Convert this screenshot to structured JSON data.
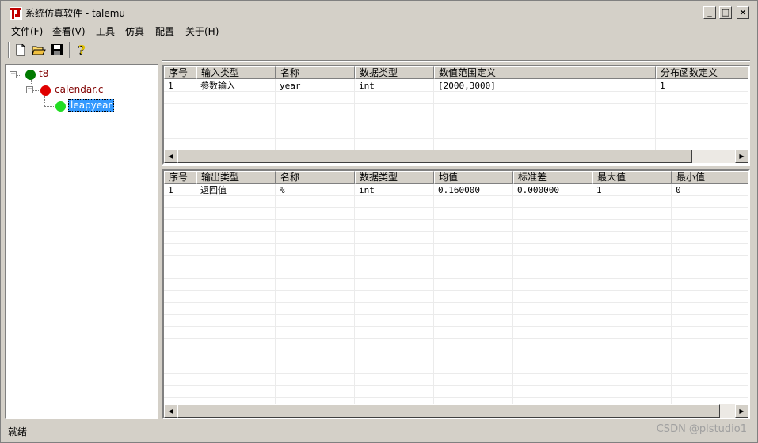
{
  "window": {
    "title": "系统仿真软件 - talemu",
    "buttons": [
      "_",
      "□",
      "×"
    ]
  },
  "menu": [
    "文件(F)",
    "查看(V)",
    "工具",
    "仿真",
    "配置",
    "关于(H)"
  ],
  "toolbar": [
    "new-file-icon",
    "open-folder-icon",
    "save-icon",
    "help-icon"
  ],
  "tree": {
    "root": "t8",
    "file": "calendar.c",
    "function": "leapyear",
    "colors": {
      "root": "#007a00",
      "file": "#e00000",
      "function": "#22dd22",
      "selected": "#3399ff"
    }
  },
  "input_table": {
    "headers": [
      "序号",
      "输入类型",
      "名称",
      "数据类型",
      "数值范围定义",
      "分布函数定义"
    ],
    "rows": [
      [
        "1",
        "参数输入",
        "year",
        "int",
        "[2000,3000]",
        "1"
      ]
    ]
  },
  "output_table": {
    "headers": [
      "序号",
      "输出类型",
      "名称",
      "数据类型",
      "均值",
      "标准差",
      "最大值",
      "最小值"
    ],
    "rows": [
      [
        "1",
        "返回值",
        "%",
        "int",
        "0.160000",
        "0.000000",
        "1",
        "0"
      ]
    ]
  },
  "status": {
    "text": "就绪"
  },
  "watermark": "CSDN @plstudio1"
}
